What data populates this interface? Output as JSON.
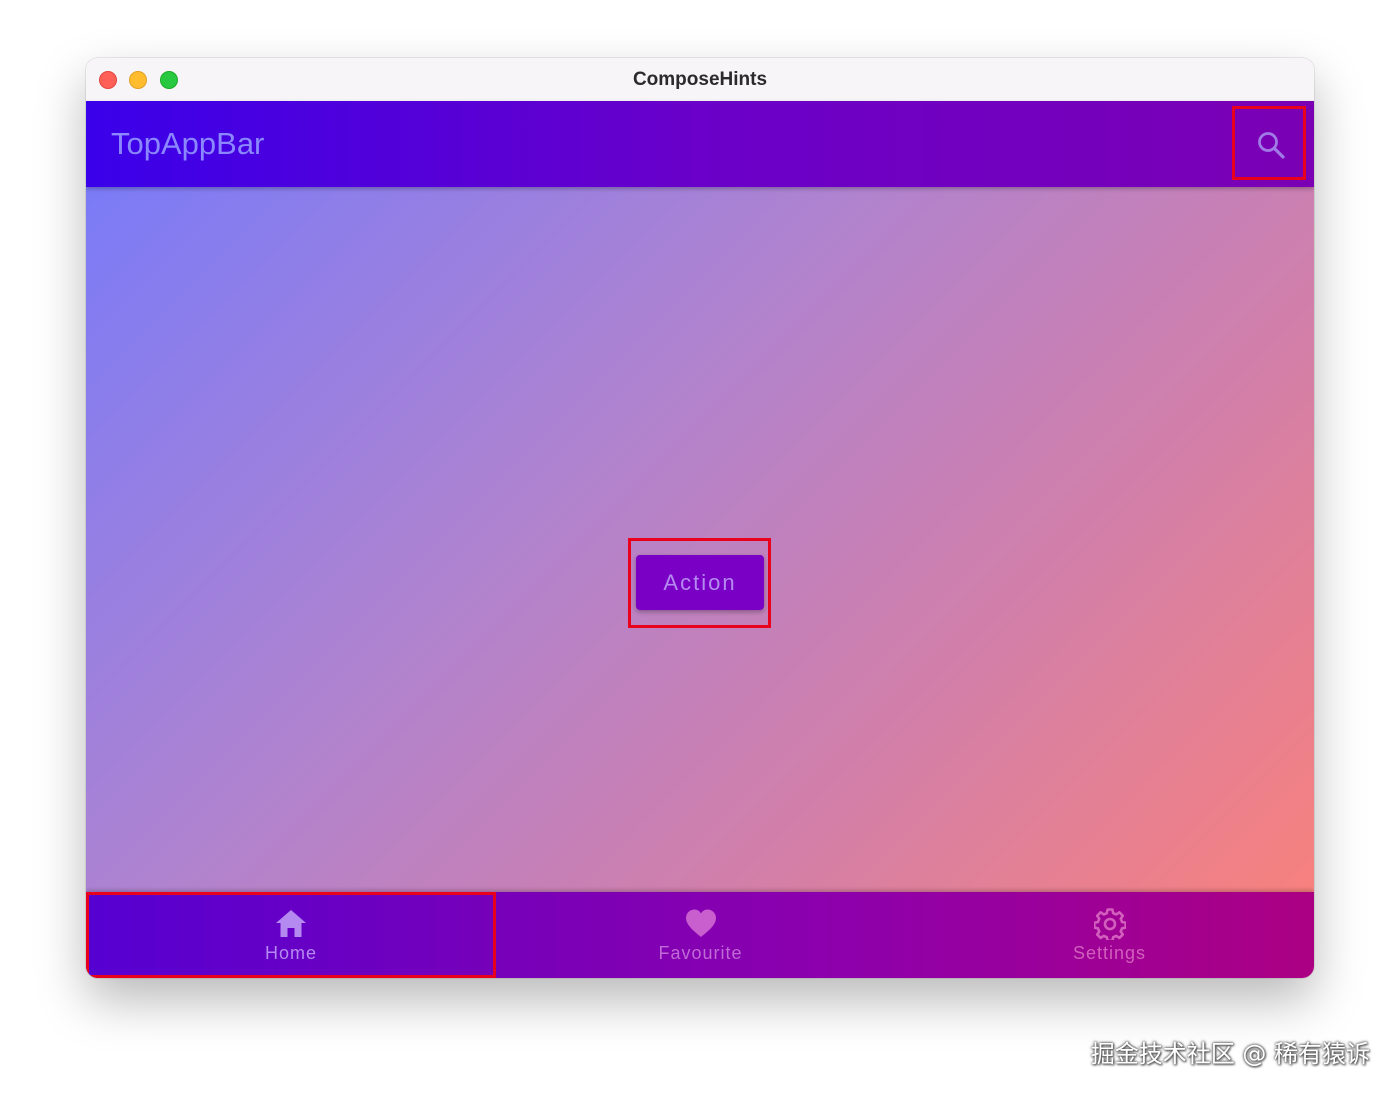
{
  "window": {
    "title": "ComposeHints"
  },
  "top_app_bar": {
    "title": "TopAppBar",
    "action_icon": "search-icon"
  },
  "content": {
    "action_button_label": "Action"
  },
  "bottom_nav": {
    "items": [
      {
        "label": "Home",
        "icon": "home-icon",
        "color": "#b58af0"
      },
      {
        "label": "Favourite",
        "icon": "heart-icon",
        "color": "#c95fcf"
      },
      {
        "label": "Settings",
        "icon": "gear-icon",
        "color": "#d25fbd"
      }
    ]
  },
  "watermark": {
    "text": "掘金技术社区 @ 稀有猿诉"
  },
  "colors": {
    "app_bar_start": "#3a00ea",
    "app_bar_end": "#7b00b4",
    "content_gradient_start": "#7b7bf7",
    "content_gradient_end": "#f7817e",
    "button": "#7a00c6",
    "highlight_border": "#e8001c"
  }
}
